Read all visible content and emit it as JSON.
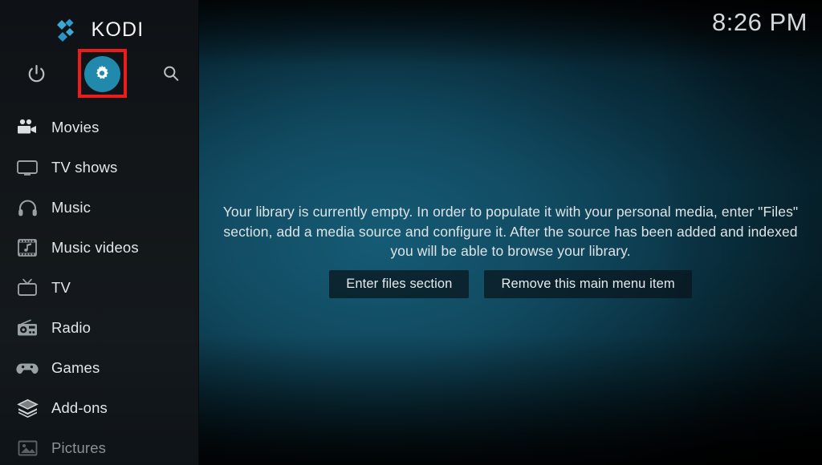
{
  "app": {
    "name": "KODI",
    "logo_icon": "kodi-logo-icon",
    "accent_color": "#2189ab",
    "sidebar_bg": "#12161a",
    "highlight_color": "#ee1b1b"
  },
  "statusbar": {
    "clock": "8:26 PM"
  },
  "toolbar": {
    "power_icon": "power-icon",
    "power_label": "Power",
    "settings_icon": "gear-icon",
    "settings_label": "Settings",
    "search_icon": "search-icon",
    "search_label": "Search"
  },
  "sidebar": {
    "items": [
      {
        "label": "Movies",
        "icon": "movie-camera-icon",
        "dimmed": false
      },
      {
        "label": "TV shows",
        "icon": "tv-monitor-icon",
        "dimmed": false
      },
      {
        "label": "Music",
        "icon": "headphones-icon",
        "dimmed": false
      },
      {
        "label": "Music videos",
        "icon": "film-music-note-icon",
        "dimmed": false
      },
      {
        "label": "TV",
        "icon": "tv-antenna-icon",
        "dimmed": false
      },
      {
        "label": "Radio",
        "icon": "radio-icon",
        "dimmed": false
      },
      {
        "label": "Games",
        "icon": "gamepad-icon",
        "dimmed": false
      },
      {
        "label": "Add-ons",
        "icon": "layers-stack-icon",
        "dimmed": false
      },
      {
        "label": "Pictures",
        "icon": "picture-frame-icon",
        "dimmed": true
      }
    ]
  },
  "main": {
    "empty_message": "Your library is currently empty. In order to populate it with your personal media, enter \"Files\" section, add a media source and configure it. After the source has been added and indexed you will be able to browse your library.",
    "buttons": [
      {
        "label": "Enter files section"
      },
      {
        "label": "Remove this main menu item"
      }
    ]
  }
}
